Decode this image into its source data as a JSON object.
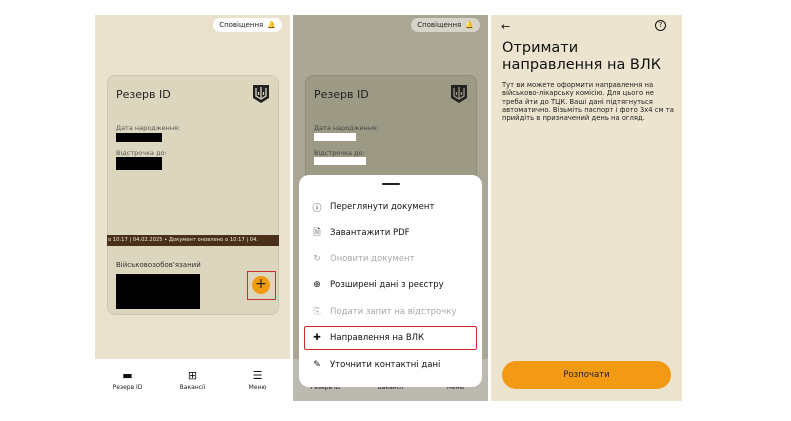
{
  "screens": {
    "home": {
      "notification_label": "Сповіщення",
      "card": {
        "title": "Резерв ID",
        "birthdate_label": "Дата народження:",
        "deferral_label": "Відстрочка до:",
        "ticker_text": "о 10:17 | 04.02.2025 • Документ оновлено о 10:17 | 04.",
        "status_label": "Військовозобов'язаний"
      },
      "fab_label": "+"
    },
    "menu_sheet": {
      "notification_label": "Сповіщення",
      "card": {
        "title": "Резерв ID",
        "birthdate_label": "Дата народження:",
        "deferral_label": "Відстрочка до:"
      },
      "items": [
        {
          "label": "Переглянути документ",
          "icon": "info-icon",
          "enabled": true
        },
        {
          "label": "Завантажити PDF",
          "icon": "file-icon",
          "enabled": true
        },
        {
          "label": "Оновити документ",
          "icon": "refresh-icon",
          "enabled": false
        },
        {
          "label": "Розширені дані з реєстру",
          "icon": "plus-circle-icon",
          "enabled": true
        },
        {
          "label": "Подати запит на відстрочку",
          "icon": "document-icon",
          "enabled": false
        },
        {
          "label": "Направлення на ВЛК",
          "icon": "medical-cross-icon",
          "enabled": true,
          "highlighted": true
        },
        {
          "label": "Уточнити контактні дані",
          "icon": "pencil-icon",
          "enabled": true
        }
      ]
    },
    "vlk": {
      "title": "Отримати направлення на ВЛК",
      "description": "Тут ви можете оформити направлення на військово-лікарську комісію. Для цього не треба йти до ТЦК. Ваші дані підтягнуться автоматично. Візьміть паспорт і фото 3х4 см та прийдіть в призначений день на огляд.",
      "help_label": "?",
      "back_label": "←",
      "start_button": "Розпочати"
    }
  },
  "nav": {
    "items": [
      {
        "label": "Резерв ID",
        "icon": "id-card-icon"
      },
      {
        "label": "Вакансії",
        "icon": "vacancies-icon"
      },
      {
        "label": "Меню",
        "icon": "menu-icon"
      }
    ]
  },
  "colors": {
    "accent": "#f39a14",
    "highlight": "#d12b2b",
    "background": "#e9e1cc",
    "ticker": "#4a3018"
  }
}
